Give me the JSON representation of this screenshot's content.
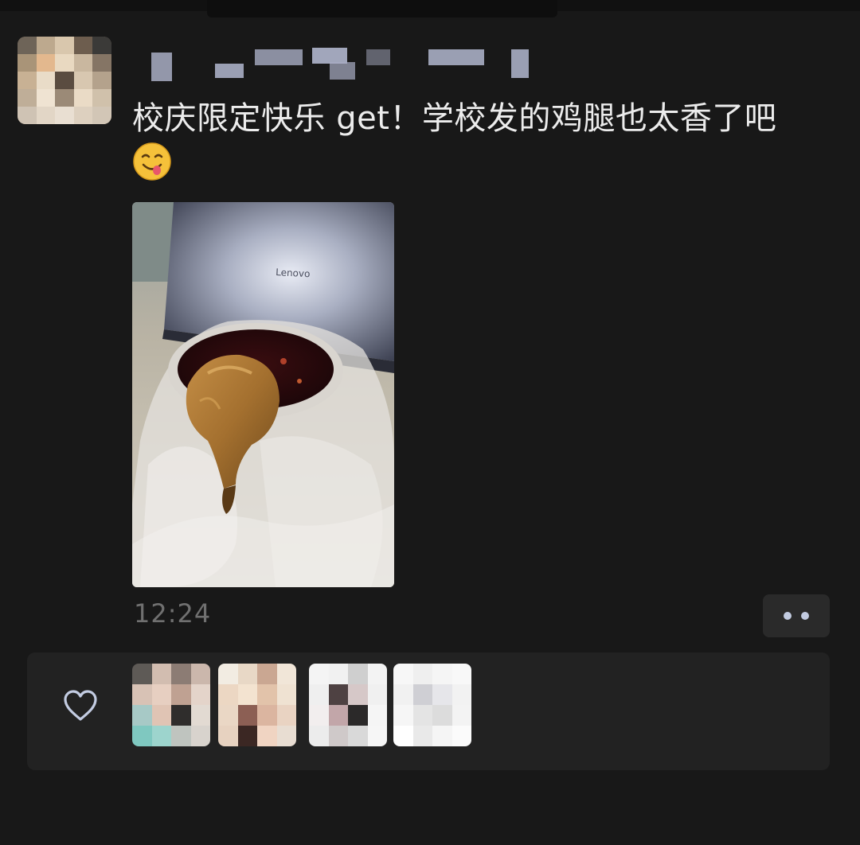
{
  "post": {
    "text": "校庆限定快乐 get！学校发的鸡腿也太香了吧",
    "emoji": "yum-face-emoji",
    "timestamp": "12:24"
  },
  "likes": {
    "icon": "heart-icon",
    "count": 4
  },
  "colors": {
    "background": "#181818",
    "panel": "#222222",
    "timestamp": "#707070",
    "more_dots": "#c2cbe0",
    "name_blur": "#a9aec4"
  }
}
